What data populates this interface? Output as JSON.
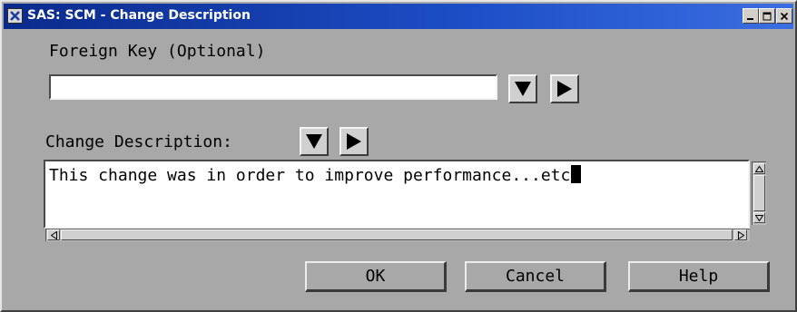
{
  "window": {
    "title": "SAS: SCM - Change Description",
    "buttons": {
      "minimize": "minimize-icon",
      "maximize": "maximize-icon",
      "close": "close-icon"
    }
  },
  "foreign_key": {
    "label": "Foreign Key (Optional)",
    "value": "",
    "dropdown_icon": "triangle-down-icon",
    "next_icon": "triangle-right-icon"
  },
  "change_description": {
    "label": "Change Description:",
    "text": "This change was in order to improve performance...etc",
    "dropdown_icon": "triangle-down-icon",
    "next_icon": "triangle-right-icon"
  },
  "actions": {
    "ok": "OK",
    "cancel": "Cancel",
    "help": "Help"
  },
  "colors": {
    "titlebar": "#0a2a8c",
    "background": "#a8a8a8"
  }
}
